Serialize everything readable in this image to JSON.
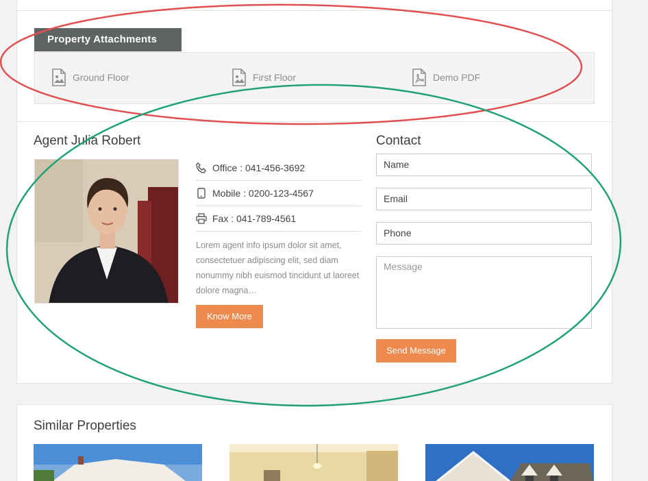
{
  "attachments": {
    "tab_label": "Property Attachments",
    "items": [
      {
        "label": "Ground Floor",
        "icon": "image-file-icon"
      },
      {
        "label": "First Floor",
        "icon": "image-file-icon"
      },
      {
        "label": "Demo PDF",
        "icon": "pdf-file-icon"
      }
    ]
  },
  "agent": {
    "title": "Agent Julia Robert",
    "office": "Office : 041-456-3692",
    "mobile": "Mobile : 0200-123-4567",
    "fax": "Fax : 041-789-4561",
    "description": "Lorem agent info ipsum dolor sit amet, consectetuer adipiscing elit, sed diam nonummy nibh euismod tincidunt ut laoreet dolore magna…",
    "button_label": "Know More"
  },
  "contact": {
    "title": "Contact",
    "name_placeholder": "Name",
    "email_placeholder": "Email",
    "phone_placeholder": "Phone",
    "message_placeholder": "Message",
    "send_label": "Send Message"
  },
  "similar": {
    "title": "Similar Properties"
  },
  "colors": {
    "accent": "#ee8a4d",
    "tab_bg": "#5f6363",
    "annotation_red": "#e05050",
    "annotation_green": "#1fa07a"
  }
}
